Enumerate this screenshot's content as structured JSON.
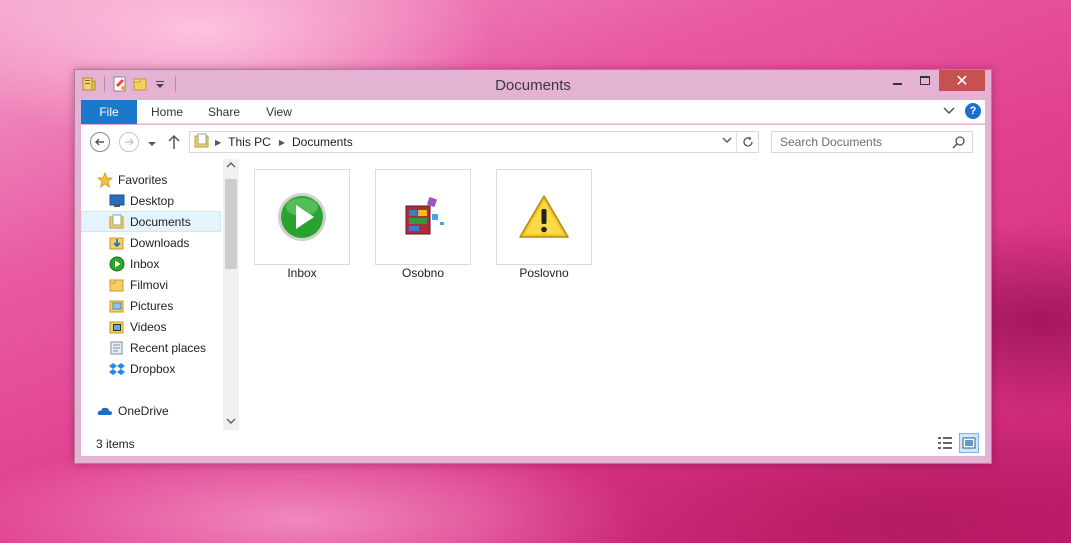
{
  "window": {
    "title": "Documents",
    "caption": {
      "minimize": "–",
      "maximize": "□",
      "close": "✕"
    }
  },
  "ribbon": {
    "tabs": [
      "File",
      "Home",
      "Share",
      "View"
    ],
    "accent": "#1979ca"
  },
  "address": {
    "segments": [
      "This PC",
      "Documents"
    ]
  },
  "search": {
    "placeholder": "Search Documents"
  },
  "nav": {
    "favorites_label": "Favorites",
    "items": [
      {
        "label": "Desktop",
        "icon": "desktop-icon"
      },
      {
        "label": "Documents",
        "icon": "documents-folder-icon",
        "selected": true
      },
      {
        "label": "Downloads",
        "icon": "downloads-folder-icon"
      },
      {
        "label": "Inbox",
        "icon": "play-icon"
      },
      {
        "label": "Filmovi",
        "icon": "folder-icon"
      },
      {
        "label": "Pictures",
        "icon": "pictures-folder-icon"
      },
      {
        "label": "Videos",
        "icon": "videos-folder-icon"
      },
      {
        "label": "Recent places",
        "icon": "recent-places-icon"
      },
      {
        "label": "Dropbox",
        "icon": "dropbox-icon"
      }
    ],
    "onedrive_label": "OneDrive"
  },
  "content": {
    "tiles": [
      {
        "label": "Inbox",
        "icon": "green-play-icon"
      },
      {
        "label": "Osobno",
        "icon": "defrag-icon"
      },
      {
        "label": "Poslovno",
        "icon": "warning-icon"
      }
    ]
  },
  "status": {
    "items_text": "3 items"
  }
}
